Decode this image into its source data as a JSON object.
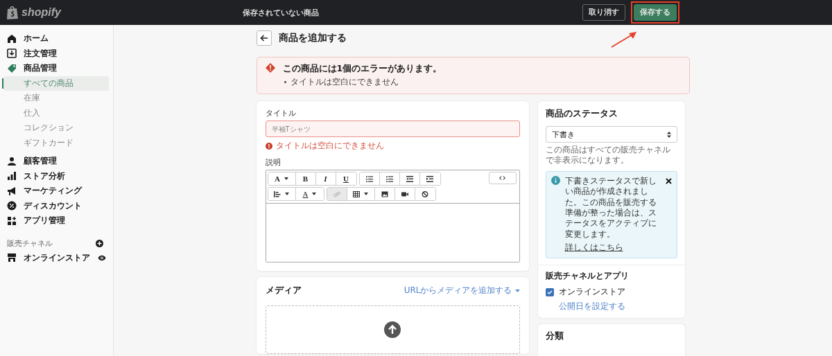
{
  "topbar": {
    "logo": "shopify",
    "title": "保存されていない商品",
    "buttons": [
      {
        "label": "取り消す",
        "kind": "secondary"
      },
      {
        "label": "保存する",
        "kind": "primary"
      }
    ]
  },
  "sidebar": {
    "items": [
      {
        "label": "ホーム",
        "selected": false
      },
      {
        "label": "注文管理",
        "selected": false
      },
      {
        "label": "商品管理",
        "selected": false,
        "children": [
          {
            "label": "すべての商品",
            "selected": true
          },
          {
            "label": "在庫",
            "selected": false
          },
          {
            "label": "仕入",
            "selected": false
          },
          {
            "label": "コレクション",
            "selected": false
          },
          {
            "label": "ギフトカード",
            "selected": false
          }
        ]
      },
      {
        "label": "顧客管理",
        "selected": false
      },
      {
        "label": "ストア分析",
        "selected": false
      },
      {
        "label": "マーケティング",
        "selected": false
      },
      {
        "label": "ディスカウント",
        "selected": false
      },
      {
        "label": "アプリ管理",
        "selected": false
      }
    ],
    "channels_heading": "販売チャネル",
    "channels": [
      {
        "label": "オンラインストア",
        "selected": false
      }
    ]
  },
  "page": {
    "title": "商品を追加する",
    "error_banner": {
      "title": "この商品には1個のエラーがあります。",
      "items": [
        "タイトルは空白にできません"
      ]
    },
    "title_field": {
      "label": "タイトル",
      "placeholder": "半袖Tシャツ",
      "error": "タイトルは空白にできません",
      "invalid": true
    },
    "description": {
      "label": "説明",
      "toolbar": [
        [
          {
            "kind": "text",
            "label": "A",
            "dropdown": true
          },
          {
            "kind": "bold",
            "label": "B"
          },
          {
            "kind": "italic",
            "label": "I"
          },
          {
            "kind": "underline",
            "label": "U"
          }
        ],
        [
          {
            "kind": "bullets"
          },
          {
            "kind": "numbers"
          },
          {
            "kind": "outdent"
          },
          {
            "kind": "indent"
          }
        ],
        [
          {
            "kind": "align",
            "dropdown": true
          },
          {
            "kind": "color",
            "label": "A",
            "dropdown": true
          }
        ],
        [
          {
            "kind": "link",
            "disabled": true
          },
          {
            "kind": "table",
            "dropdown": true
          },
          {
            "kind": "image"
          },
          {
            "kind": "video"
          },
          {
            "kind": "clear"
          }
        ]
      ]
    },
    "media": {
      "title": "メディア",
      "link": "URLからメディアを追加する"
    },
    "status": {
      "title": "商品のステータス",
      "value": "下書き",
      "help": "この商品はすべての販売チャネルで非表示になります。",
      "notice": {
        "text": "下書きステータスで新しい商品が作成されました。この商品を販売する準備が整った場合は、ステータスをアクティブに変更します。",
        "link": "詳しくはこちら"
      },
      "channels_title": "販売チャネルとアプリ",
      "channels": [
        {
          "label": "オンラインストア",
          "checked": true,
          "link": "公開日を設定する"
        }
      ]
    },
    "organization": {
      "title": "分類"
    }
  }
}
